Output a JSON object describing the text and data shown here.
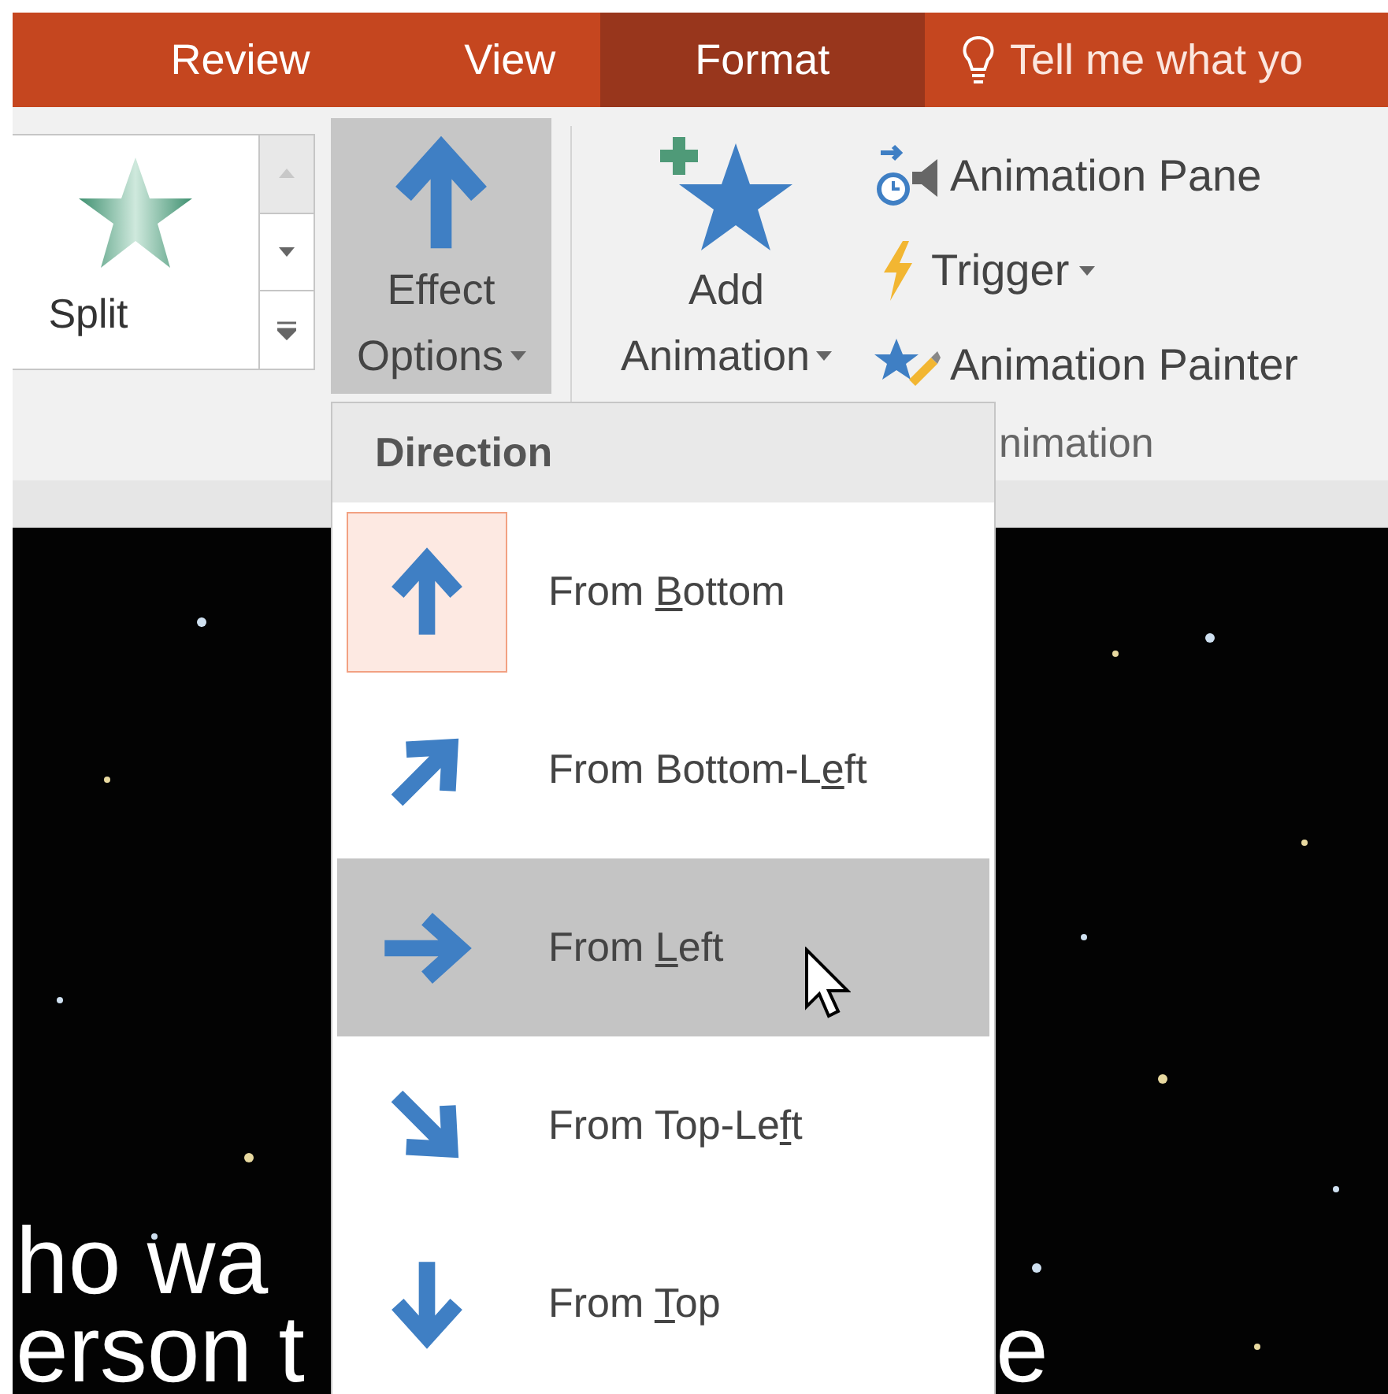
{
  "tabs": [
    {
      "label": "Review",
      "selected": false
    },
    {
      "label": "View",
      "selected": false
    },
    {
      "label": "Format",
      "selected": true
    }
  ],
  "tell_me": {
    "placeholder": "Tell me what yo"
  },
  "gallery": {
    "item": {
      "label": "Split"
    },
    "scroll_up": {
      "disabled": true
    }
  },
  "effect_options": {
    "label_lines": [
      "Effect",
      "Options"
    ],
    "pressed": true
  },
  "add_animation": {
    "label_lines": [
      "Add",
      "Animation"
    ]
  },
  "small_buttons": [
    {
      "kind": "pane",
      "label": "Animation Pane",
      "dropdown": false
    },
    {
      "kind": "trigger",
      "label": "Trigger",
      "dropdown": true
    },
    {
      "kind": "painter",
      "label": "Animation Painter",
      "dropdown": false
    }
  ],
  "group_label": "nimation",
  "menu": {
    "header": "Direction",
    "items": [
      {
        "kind": "up",
        "before": "From ",
        "key": "B",
        "after": "ottom",
        "selected": true,
        "hovered": false
      },
      {
        "kind": "up-right",
        "before": "From Bottom-L",
        "key": "e",
        "after": "ft",
        "selected": false,
        "hovered": false
      },
      {
        "kind": "right",
        "before": "From ",
        "key": "L",
        "after": "eft",
        "selected": false,
        "hovered": true
      },
      {
        "kind": "down-right",
        "before": "From Top-Le",
        "key": "f",
        "after": "t",
        "selected": false,
        "hovered": false
      },
      {
        "kind": "down",
        "before": "From ",
        "key": "T",
        "after": "op",
        "selected": false,
        "hovered": false
      }
    ]
  },
  "slide": {
    "lines": [
      "ho wa",
      "erson t"
    ],
    "right_fragment": "e"
  }
}
